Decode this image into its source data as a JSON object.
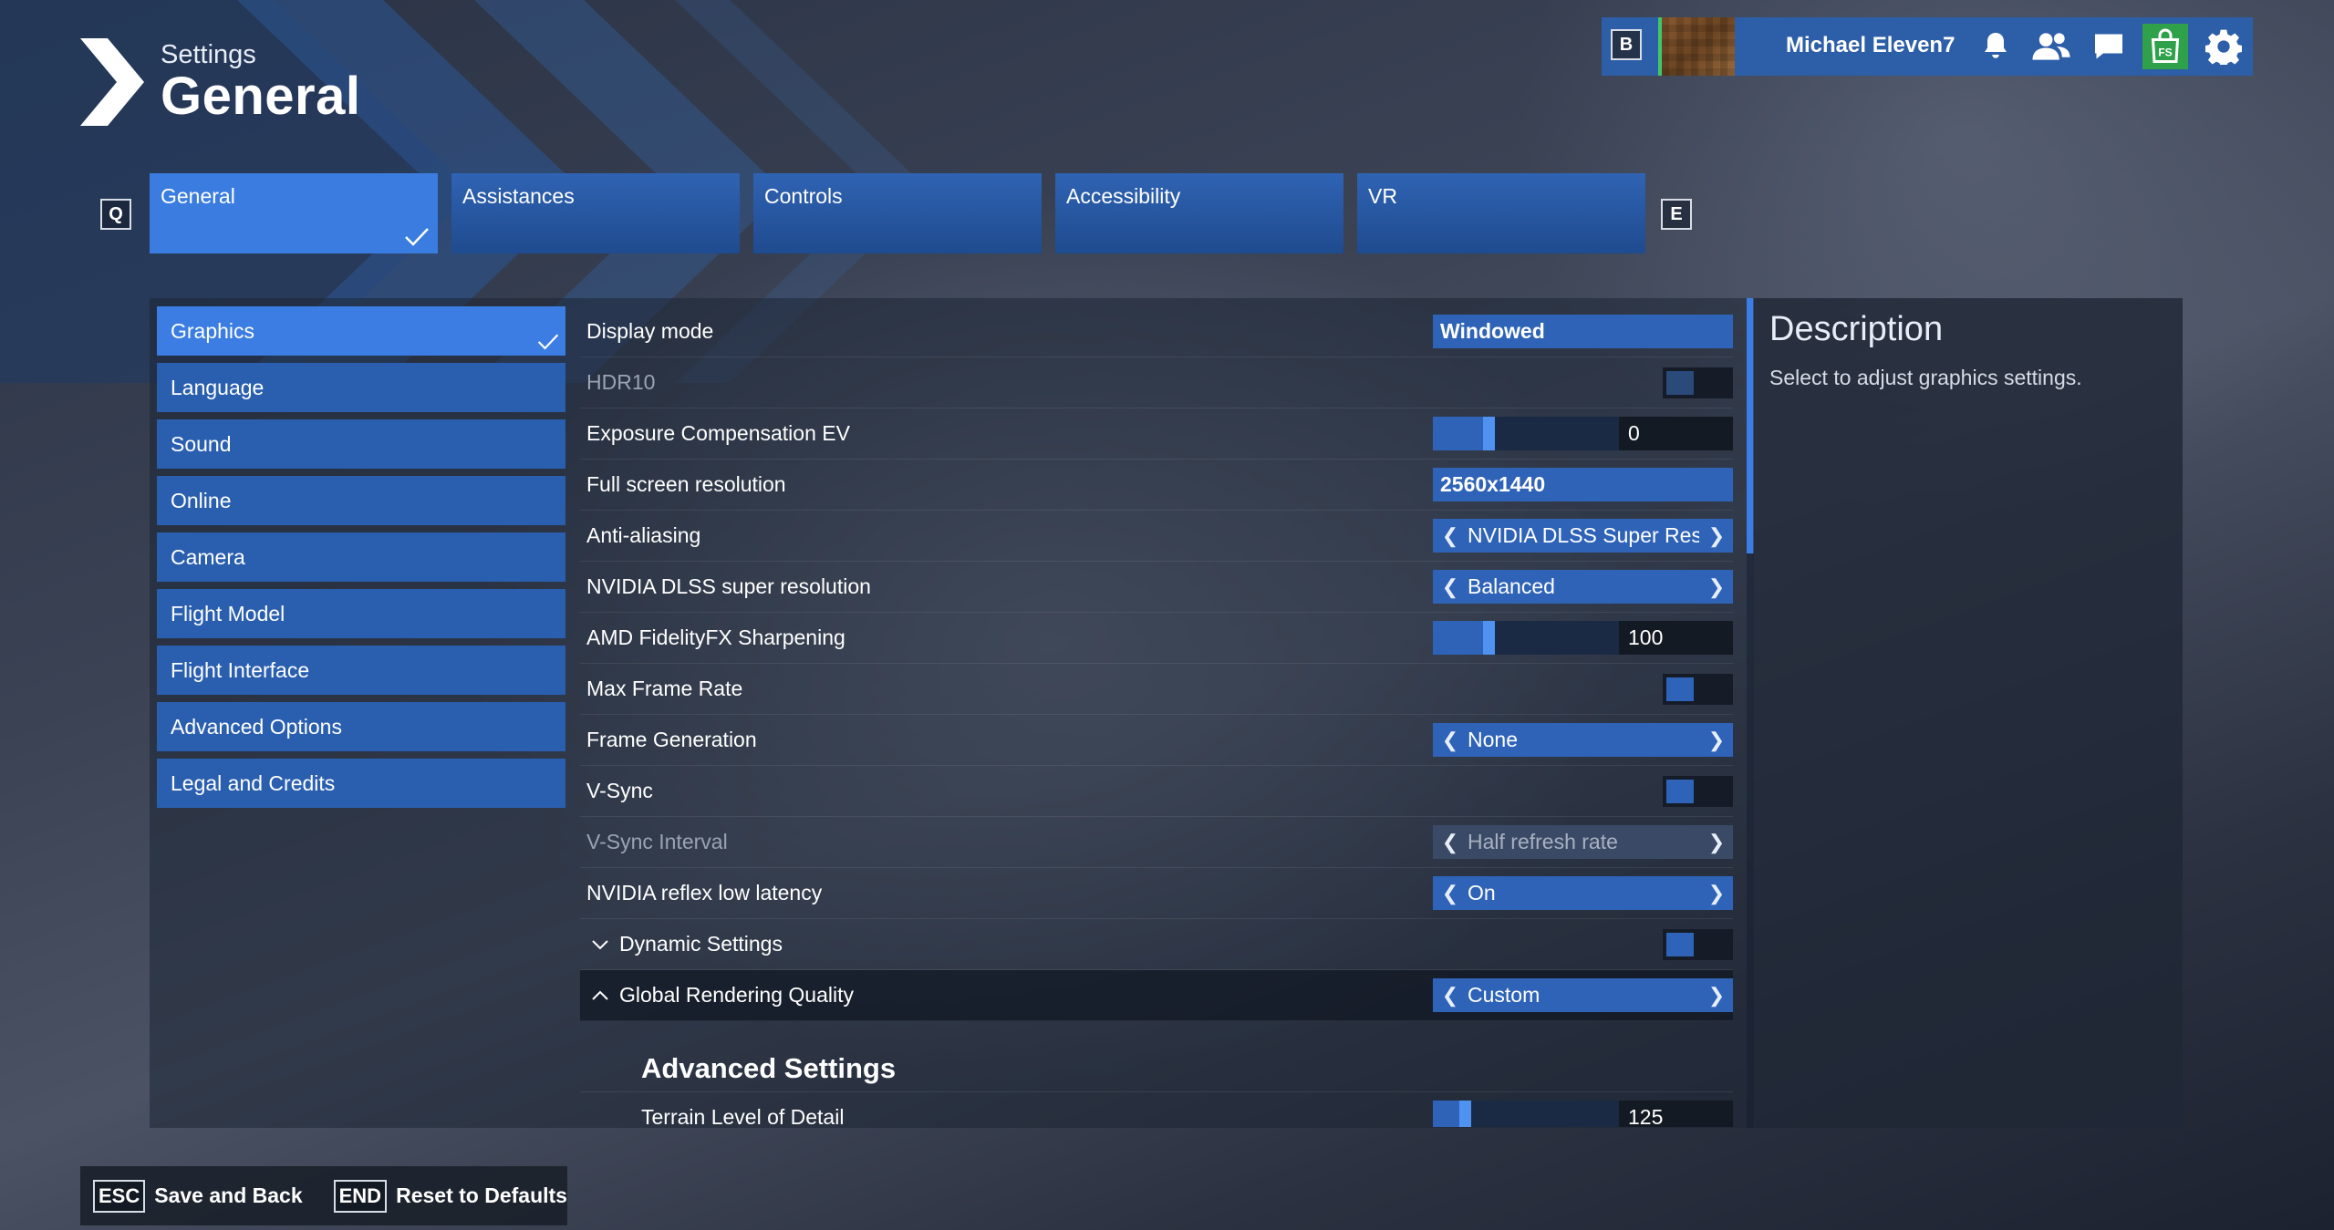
{
  "header": {
    "small_title": "Settings",
    "big_title": "General"
  },
  "topbar": {
    "key_b": "B",
    "username": "Michael Eleven7",
    "icons": [
      "bell-icon",
      "friends-icon",
      "chat-icon",
      "store-icon",
      "gear-icon"
    ]
  },
  "tabs": {
    "key_left": "Q",
    "key_right": "E",
    "items": [
      {
        "label": "General",
        "active": true
      },
      {
        "label": "Assistances"
      },
      {
        "label": "Controls"
      },
      {
        "label": "Accessibility"
      },
      {
        "label": "VR"
      }
    ]
  },
  "sidebar": {
    "items": [
      {
        "label": "Graphics",
        "active": true
      },
      {
        "label": "Language"
      },
      {
        "label": "Sound"
      },
      {
        "label": "Online"
      },
      {
        "label": "Camera"
      },
      {
        "label": "Flight Model"
      },
      {
        "label": "Flight Interface"
      },
      {
        "label": "Advanced Options"
      },
      {
        "label": "Legal and Credits"
      }
    ]
  },
  "settings": {
    "display_mode": {
      "label": "Display mode",
      "value": "Windowed"
    },
    "hdr10": {
      "label": "HDR10",
      "enabled": false
    },
    "exposure": {
      "label": "Exposure Compensation EV",
      "value": "0",
      "level": 0.3
    },
    "resolution": {
      "label": "Full screen resolution",
      "value": "2560x1440"
    },
    "anti_aliasing": {
      "label": "Anti-aliasing",
      "value": "NVIDIA DLSS Super Resolution"
    },
    "dlss": {
      "label": "NVIDIA DLSS super resolution",
      "value": "Balanced"
    },
    "fidelityfx": {
      "label": "AMD FidelityFX Sharpening",
      "value": "100",
      "level": 0.3
    },
    "max_frame_rate": {
      "label": "Max Frame Rate"
    },
    "frame_gen": {
      "label": "Frame Generation",
      "value": "None"
    },
    "vsync": {
      "label": "V-Sync"
    },
    "vsync_interval": {
      "label": "V-Sync Interval",
      "value": "Half refresh rate"
    },
    "reflex": {
      "label": "NVIDIA reflex low latency",
      "value": "On"
    },
    "dynamic_settings": {
      "label": "Dynamic Settings"
    },
    "global_quality": {
      "label": "Global Rendering Quality",
      "value": "Custom"
    },
    "advanced_title": "Advanced Settings",
    "terrain_lod": {
      "label": "Terrain Level of Detail",
      "value": "125",
      "level": 0.17
    }
  },
  "description": {
    "title": "Description",
    "text": "Select to adjust graphics settings."
  },
  "footer": {
    "esc_key": "ESC",
    "esc_label": "Save and Back",
    "end_key": "END",
    "end_label": "Reset to Defaults"
  },
  "colors": {
    "accent": "#2e63b8",
    "active": "#3b7de2",
    "store": "#2fa14a"
  }
}
